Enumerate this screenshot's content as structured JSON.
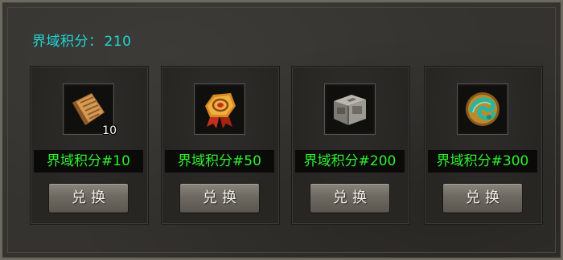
{
  "header": {
    "label": "界域积分：",
    "value": "210"
  },
  "items": [
    {
      "icon": "scroll-icon",
      "count": "10",
      "cost": "界域积分#10",
      "button": "兑换"
    },
    {
      "icon": "medal-badge-icon",
      "count": "",
      "cost": "界域积分#50",
      "button": "兑换"
    },
    {
      "icon": "stone-chest-icon",
      "count": "",
      "cost": "界域积分#200",
      "button": "兑换"
    },
    {
      "icon": "jade-dragon-emblem-icon",
      "count": "",
      "cost": "界域积分#300",
      "button": "兑换"
    }
  ]
}
